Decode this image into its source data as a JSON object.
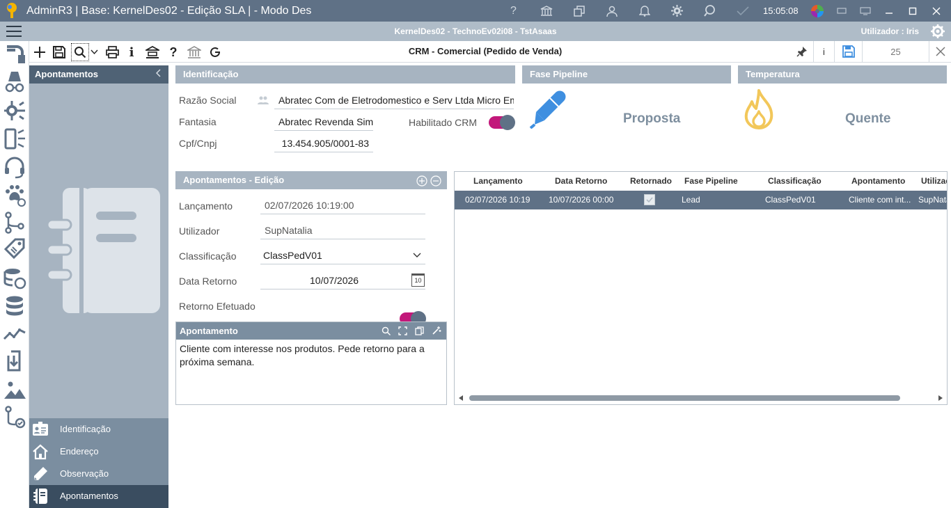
{
  "window": {
    "title": "AdminR3 | Base: KernelDes02 - Edição SLA | - Modo Des",
    "clock": "15:05:08",
    "header_center": "KernelDes02 - TechnoEv02i08 - TstAsaas",
    "user_label": "Utilizador : Iris"
  },
  "toolbar": {
    "form_title": "CRM - Comercial (Pedido de Venda)",
    "record_number": "25",
    "info_glyph": "i",
    "help_glyph": "?"
  },
  "sidebar": {
    "title": "Apontamentos",
    "menu": [
      {
        "label": "Identificação",
        "icon": "id-card-icon"
      },
      {
        "label": "Endereço",
        "icon": "home-icon"
      },
      {
        "label": "Observação",
        "icon": "pencil-icon"
      },
      {
        "label": "Apontamentos",
        "icon": "notebook-icon"
      }
    ]
  },
  "identificacao": {
    "title": "Identificação",
    "razao_label": "Razão Social",
    "razao_value": "Abratec Com de Eletrodomestico e Serv Ltda Micro Em",
    "fantasia_label": "Fantasia",
    "fantasia_value": "Abratec Revenda Sim",
    "cnpj_label": "Cpf/Cnpj",
    "cnpj_value": "13.454.905/0001-83",
    "habilitado_label": "Habilitado CRM",
    "habilitado": true
  },
  "fase": {
    "title": "Fase Pipeline",
    "value": "Proposta"
  },
  "temperatura": {
    "title": "Temperatura",
    "value": "Quente"
  },
  "edicao": {
    "title": "Apontamentos - Edição",
    "lancamento_label": "Lançamento",
    "lancamento_value": "02/07/2026 10:19:00",
    "utilizador_label": "Utilizador",
    "utilizador_value": "SupNatalia",
    "classificacao_label": "Classificação",
    "classificacao_value": "ClassPedV01",
    "data_retorno_label": "Data Retorno",
    "data_retorno_value": "10/07/2026",
    "calendar_day": "10",
    "retorno_label": "Retorno Efetuado",
    "retorno_efetuado": true
  },
  "apontamento": {
    "title": "Apontamento",
    "text": "Cliente com interesse nos produtos. Pede retorno para a próxima semana."
  },
  "grid": {
    "headers": [
      "Lançamento",
      "Data Retorno",
      "Retornado",
      "Fase Pipeline",
      "Classificação",
      "Apontamento",
      "Utilizad"
    ],
    "rows": [
      {
        "lancamento": "02/07/2026 10:19",
        "data_retorno": "10/07/2026 00:00",
        "retornado": true,
        "fase": "Lead",
        "classificacao": "ClassPedV01",
        "apontamento": "Cliente com int...",
        "utilizador": "SupNata"
      }
    ]
  },
  "colors": {
    "titlebar": "#5f7186",
    "section_header": "#a7b4c1",
    "toggle_on": "#c2187a",
    "pen_blue": "#3f8fe0",
    "flame_yellow": "#f2c75a"
  }
}
